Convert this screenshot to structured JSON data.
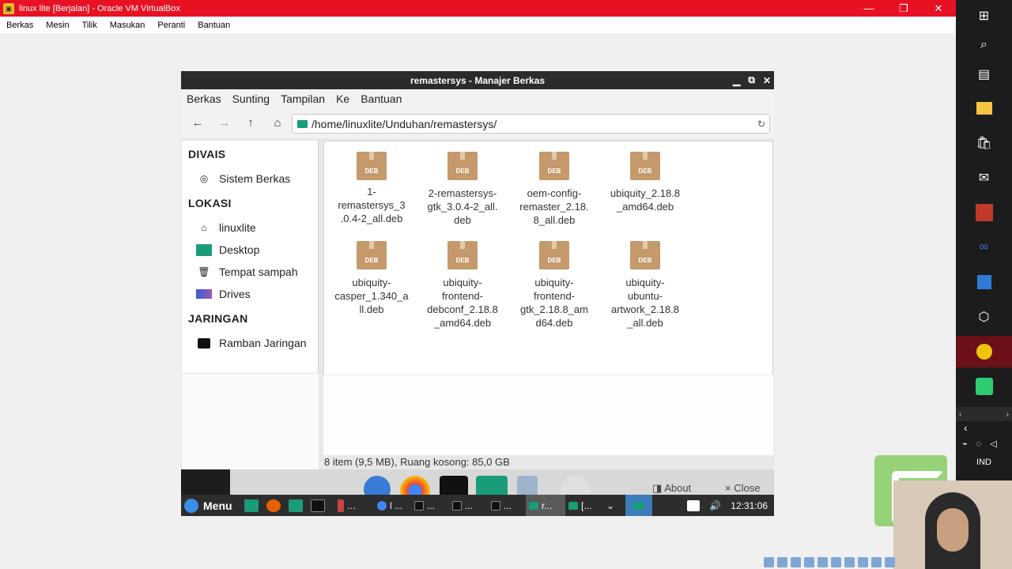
{
  "host": {
    "title": "linux lite [Berjalan] - Oracle VM VirtualBox",
    "controls": [
      "—",
      "❐",
      "✕"
    ],
    "menu": [
      "Berkas",
      "Mesin",
      "Tilik",
      "Masukan",
      "Peranti",
      "Bantuan"
    ]
  },
  "filemanager": {
    "title": "remastersys - Manajer Berkas",
    "menu": [
      "Berkas",
      "Sunting",
      "Tampilan",
      "Ke",
      "Bantuan"
    ],
    "path": "/home/linuxlite/Unduhan/remastersys/",
    "sidebar": {
      "devices_header": "DIVAIS",
      "devices": [
        {
          "label": "Sistem Berkas",
          "icon": "disk-icon"
        }
      ],
      "places_header": "LOKASI",
      "places": [
        {
          "label": "linuxlite",
          "icon": "home-icon"
        },
        {
          "label": "Desktop",
          "icon": "desktop-icon"
        },
        {
          "label": "Tempat sampah",
          "icon": "trash-icon"
        },
        {
          "label": "Drives",
          "icon": "drives-icon"
        }
      ],
      "network_header": "JARINGAN",
      "network": [
        {
          "label": "Ramban Jaringan",
          "icon": "network-icon"
        }
      ]
    },
    "package_badge": "DEB",
    "files": [
      {
        "name": "1-\nremastersys_3\n.0.4-2_all.deb"
      },
      {
        "name": "2-remastersys-\ngtk_3.0.4-2_all.\ndeb"
      },
      {
        "name": "oem-config-\nremaster_2.18.\n8_all.deb"
      },
      {
        "name": "ubiquity_2.18.8\n_amd64.deb"
      },
      {
        "name": "ubiquity-\ncasper_1.340_a\nll.deb"
      },
      {
        "name": "ubiquity-\nfrontend-\ndebconf_2.18.8\n_amd64.deb"
      },
      {
        "name": "ubiquity-\nfrontend-\ngtk_2.18.8_am\nd64.deb"
      },
      {
        "name": "ubiquity-\nubuntu-\nartwork_2.18.8\n_all.deb"
      }
    ],
    "status": "8  item  (9,5  MB),  Ruang kosong:  85,0  GB"
  },
  "dock": {
    "about": "About",
    "close": "Close"
  },
  "panel": {
    "menu_label": "Menu",
    "tasks": [
      "l ...",
      "...",
      "...",
      "r...",
      "[..."
    ],
    "clock": "12:31:06"
  },
  "windows": {
    "lang": "IND"
  },
  "colors": {
    "host_title": "#e81123",
    "guest_accent": "#1a9b7a",
    "deb_package": "#c49a6c"
  }
}
